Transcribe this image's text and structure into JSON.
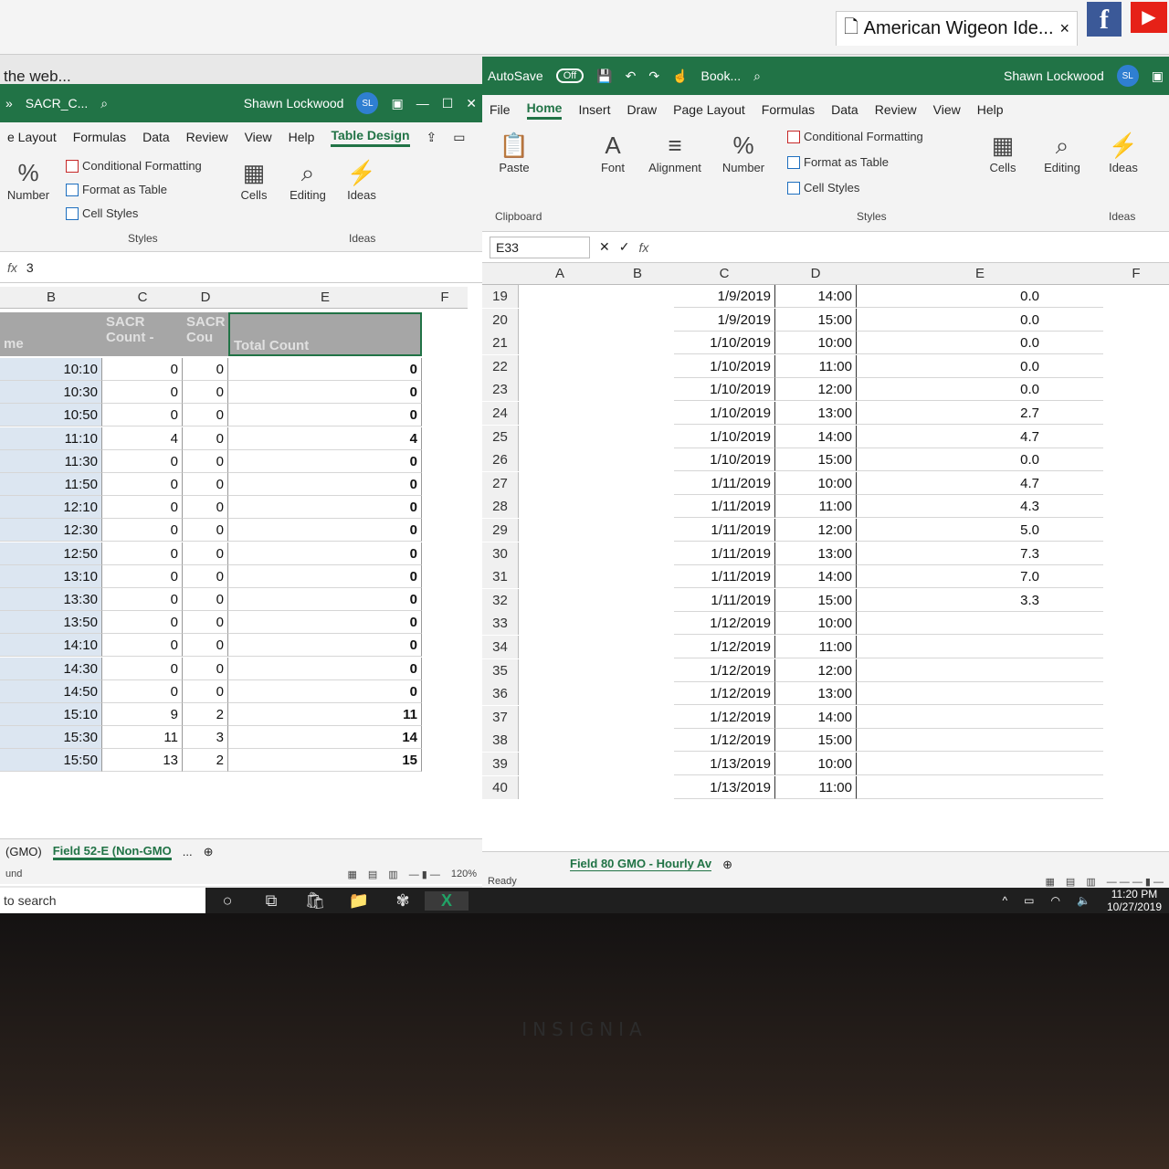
{
  "browser": {
    "tab_title": "American Wigeon Ide...",
    "tab_close": "×",
    "address": "the web...",
    "fb": "f",
    "yt": "▶"
  },
  "left": {
    "title": "SACR_C...",
    "user": "Shawn Lockwood",
    "initials": "SL",
    "menu": [
      "e Layout",
      "Formulas",
      "Data",
      "Review",
      "View",
      "Help",
      "Table Design"
    ],
    "ribbon": {
      "number": "Number",
      "cond": "Conditional Formatting",
      "fmt_table": "Format as Table",
      "cell_styles": "Cell Styles",
      "styles": "Styles",
      "cells": "Cells",
      "editing": "Editing",
      "ideas": "Ideas",
      "ideas_group": "Ideas"
    },
    "formula_value": "3",
    "columns": [
      "B",
      "C",
      "D",
      "E",
      "F"
    ],
    "headers": {
      "b": "me",
      "c": "SACR Count -",
      "d": "SACR Cou",
      "e": "Total Count"
    },
    "rows": [
      {
        "b": "10:10",
        "c": "0",
        "d": "0",
        "e": "0"
      },
      {
        "b": "10:30",
        "c": "0",
        "d": "0",
        "e": "0"
      },
      {
        "b": "10:50",
        "c": "0",
        "d": "0",
        "e": "0"
      },
      {
        "b": "11:10",
        "c": "4",
        "d": "0",
        "e": "4"
      },
      {
        "b": "11:30",
        "c": "0",
        "d": "0",
        "e": "0"
      },
      {
        "b": "11:50",
        "c": "0",
        "d": "0",
        "e": "0"
      },
      {
        "b": "12:10",
        "c": "0",
        "d": "0",
        "e": "0"
      },
      {
        "b": "12:30",
        "c": "0",
        "d": "0",
        "e": "0"
      },
      {
        "b": "12:50",
        "c": "0",
        "d": "0",
        "e": "0"
      },
      {
        "b": "13:10",
        "c": "0",
        "d": "0",
        "e": "0"
      },
      {
        "b": "13:30",
        "c": "0",
        "d": "0",
        "e": "0"
      },
      {
        "b": "13:50",
        "c": "0",
        "d": "0",
        "e": "0"
      },
      {
        "b": "14:10",
        "c": "0",
        "d": "0",
        "e": "0"
      },
      {
        "b": "14:30",
        "c": "0",
        "d": "0",
        "e": "0"
      },
      {
        "b": "14:50",
        "c": "0",
        "d": "0",
        "e": "0"
      },
      {
        "b": "15:10",
        "c": "9",
        "d": "2",
        "e": "11"
      },
      {
        "b": "15:30",
        "c": "11",
        "d": "3",
        "e": "14"
      },
      {
        "b": "15:50",
        "c": "13",
        "d": "2",
        "e": "15"
      }
    ],
    "tabs": [
      "(GMO)",
      "Field 52-E (Non-GMO",
      "..."
    ],
    "status_left": "und",
    "zoom": "120%"
  },
  "right": {
    "autosave": "AutoSave",
    "toggle": "Off",
    "book": "Book...",
    "user": "Shawn Lockwood",
    "initials": "SL",
    "menu": [
      "File",
      "Home",
      "Insert",
      "Draw",
      "Page Layout",
      "Formulas",
      "Data",
      "Review",
      "View",
      "Help"
    ],
    "ribbon": {
      "paste": "Paste",
      "clipboard": "Clipboard",
      "font": "Font",
      "alignment": "Alignment",
      "number": "Number",
      "cond": "Conditional Formatting",
      "fmt_table": "Format as Table",
      "cell_styles": "Cell Styles",
      "styles": "Styles",
      "cells": "Cells",
      "editing": "Editing",
      "ideas": "Ideas",
      "ideas_group": "Ideas"
    },
    "namebox": "E33",
    "columns": [
      "A",
      "B",
      "C",
      "D",
      "E",
      "F"
    ],
    "rows": [
      {
        "n": "19",
        "c": "1/9/2019",
        "d": "14:00",
        "e": "0.0"
      },
      {
        "n": "20",
        "c": "1/9/2019",
        "d": "15:00",
        "e": "0.0"
      },
      {
        "n": "21",
        "c": "1/10/2019",
        "d": "10:00",
        "e": "0.0"
      },
      {
        "n": "22",
        "c": "1/10/2019",
        "d": "11:00",
        "e": "0.0"
      },
      {
        "n": "23",
        "c": "1/10/2019",
        "d": "12:00",
        "e": "0.0"
      },
      {
        "n": "24",
        "c": "1/10/2019",
        "d": "13:00",
        "e": "2.7"
      },
      {
        "n": "25",
        "c": "1/10/2019",
        "d": "14:00",
        "e": "4.7"
      },
      {
        "n": "26",
        "c": "1/10/2019",
        "d": "15:00",
        "e": "0.0"
      },
      {
        "n": "27",
        "c": "1/11/2019",
        "d": "10:00",
        "e": "4.7"
      },
      {
        "n": "28",
        "c": "1/11/2019",
        "d": "11:00",
        "e": "4.3"
      },
      {
        "n": "29",
        "c": "1/11/2019",
        "d": "12:00",
        "e": "5.0"
      },
      {
        "n": "30",
        "c": "1/11/2019",
        "d": "13:00",
        "e": "7.3"
      },
      {
        "n": "31",
        "c": "1/11/2019",
        "d": "14:00",
        "e": "7.0"
      },
      {
        "n": "32",
        "c": "1/11/2019",
        "d": "15:00",
        "e": "3.3"
      },
      {
        "n": "33",
        "c": "1/12/2019",
        "d": "10:00",
        "e": ""
      },
      {
        "n": "34",
        "c": "1/12/2019",
        "d": "11:00",
        "e": ""
      },
      {
        "n": "35",
        "c": "1/12/2019",
        "d": "12:00",
        "e": ""
      },
      {
        "n": "36",
        "c": "1/12/2019",
        "d": "13:00",
        "e": ""
      },
      {
        "n": "37",
        "c": "1/12/2019",
        "d": "14:00",
        "e": ""
      },
      {
        "n": "38",
        "c": "1/12/2019",
        "d": "15:00",
        "e": ""
      },
      {
        "n": "39",
        "c": "1/13/2019",
        "d": "10:00",
        "e": ""
      },
      {
        "n": "40",
        "c": "1/13/2019",
        "d": "11:00",
        "e": ""
      }
    ],
    "tab": "Field 80 GMO - Hourly Av",
    "status": "Ready"
  },
  "taskbar": {
    "search": "to search",
    "time": "11:20 PM",
    "date": "10/27/2019"
  },
  "bezel_brand": "INSIGNIA"
}
